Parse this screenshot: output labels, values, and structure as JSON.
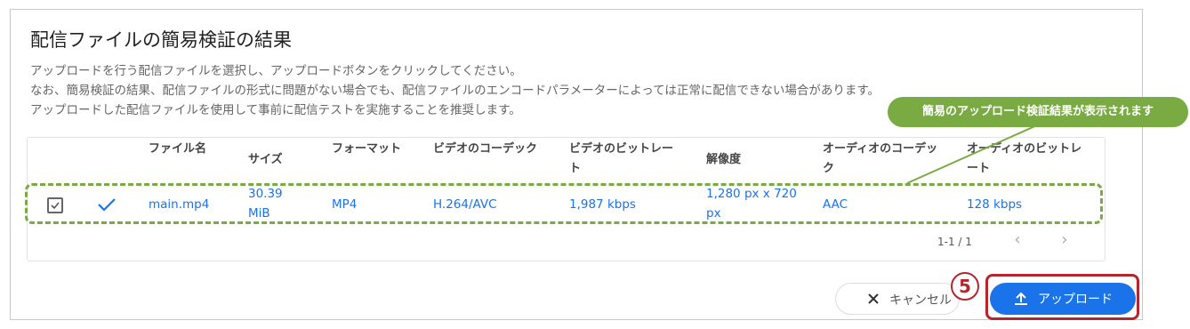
{
  "dialog": {
    "title": "配信ファイルの簡易検証の結果",
    "description": [
      "アップロードを行う配信ファイルを選択し、アップロードボタンをクリックしてください。",
      "なお、簡易検証の結果、配信ファイルの形式に問題がない場合でも、配信ファイルのエンコードパラメーターによっては正常に配信できない場合があります。",
      "アップロードした配信ファイルを使用して事前に配信テストを実施することを推奨します。"
    ]
  },
  "table": {
    "headers": {
      "filename": "ファイル名",
      "size": "サイズ",
      "format": "フォーマット",
      "video_codec": "ビデオのコーデック",
      "video_bitrate_1": "ビデオのビットレー",
      "video_bitrate_2": "ト",
      "resolution": "解像度",
      "audio_codec_1": "オーディオのコーデッ",
      "audio_codec_2": "ク",
      "audio_bitrate_1": "オーディオのビットレ",
      "audio_bitrate_2": "ート"
    },
    "rows": [
      {
        "checked": true,
        "filename": "main.mp4",
        "size_1": "30.39",
        "size_2": "MiB",
        "format": "MP4",
        "video_codec": "H.264/AVC",
        "video_bitrate": "1,987 kbps",
        "resolution_1": "1,280 px x 720",
        "resolution_2": "px",
        "audio_codec": "AAC",
        "audio_bitrate": "128 kbps"
      }
    ],
    "pager": {
      "range": "1-1 / 1",
      "prev": "‹",
      "next": "›"
    }
  },
  "callout": {
    "text": "簡易のアップロード検証結果が表示されます"
  },
  "buttons": {
    "cancel": "キャンセル",
    "upload": "アップロード"
  },
  "step_marker": "5",
  "colors": {
    "accent": "#1a73e8",
    "highlight": "#7aab43",
    "marker": "#b3262e"
  }
}
